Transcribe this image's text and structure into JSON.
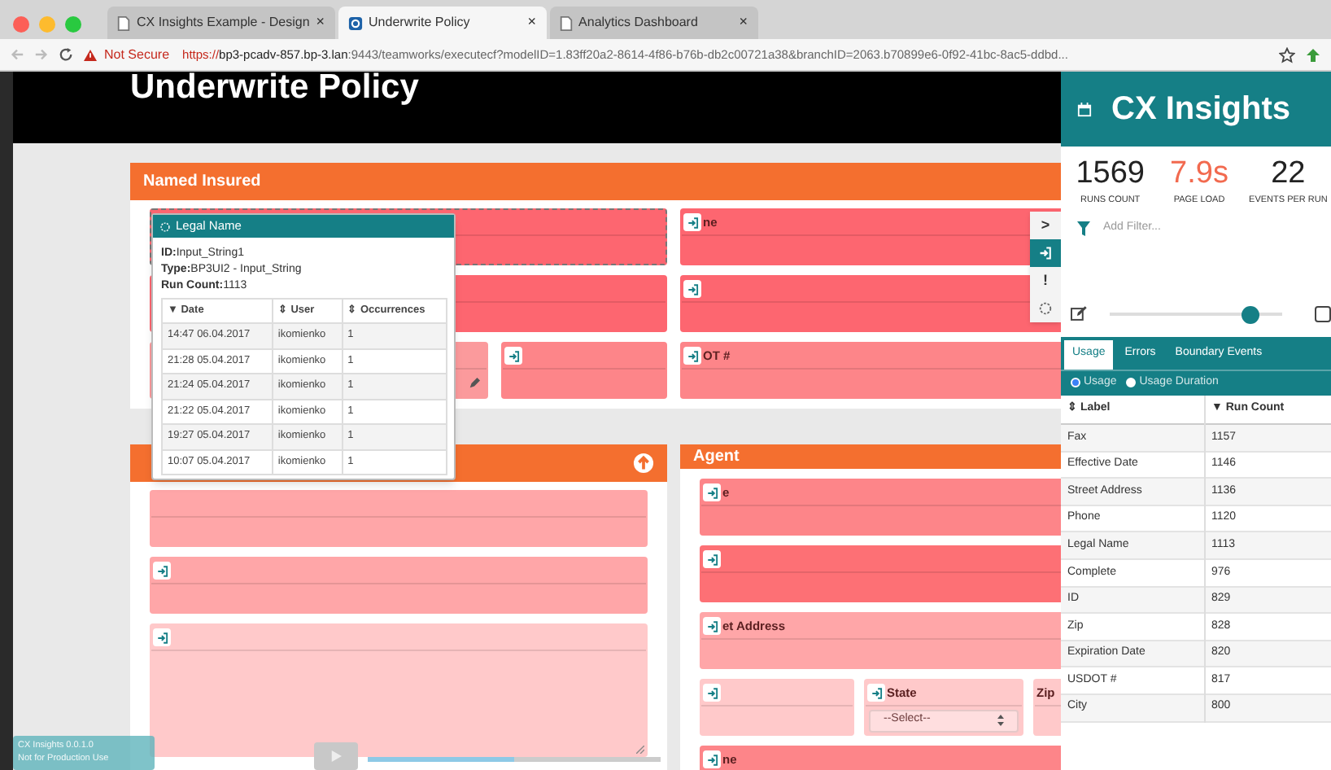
{
  "browser": {
    "tabs": [
      {
        "label": "CX Insights Example - Design",
        "close": "×",
        "selected": false
      },
      {
        "label": "Underwrite Policy",
        "close": "×",
        "selected": true
      },
      {
        "label": "Analytics Dashboard",
        "close": "×",
        "selected": false
      }
    ],
    "security": "Not Secure",
    "url_scheme": "https://",
    "url_host": "bp3-pcadv-857.bp-3.lan",
    "url_rest": ":9443/teamworks/executecf?modelID=1.83ff20a2-8614-4f86-b76b-db2c00721a38&branchID=2063.b70899e6-0f92-41bc-8ac5-ddbd..."
  },
  "page": {
    "title": "Underwrite Policy",
    "cards": [
      {
        "title": "Named Insured",
        "rows": [
          [
            {
              "color": "#fd6670",
              "icon": false,
              "selected": true
            },
            {
              "label": "ne",
              "color": "#fd6670",
              "icon": true,
              "selected": false
            }
          ],
          [
            {
              "color": "#fd6670",
              "icon": false,
              "selected": false
            },
            {
              "color": "#fd6670",
              "icon": true,
              "selected": false
            }
          ],
          [
            {
              "color": "#fb9a9c",
              "icon": false,
              "selected": false,
              "kind": "edit"
            },
            {
              "color": "#fd8589",
              "icon": true,
              "selected": false
            },
            {
              "label": "OT #",
              "color": "#fd8589",
              "icon": true,
              "selected": false
            }
          ]
        ]
      },
      {
        "rows": [
          [
            {
              "color": "#ffa6a8",
              "icon": false,
              "selected": false
            }
          ],
          [
            {
              "color": "#ffa6a8",
              "icon": true,
              "selected": false
            }
          ],
          [
            {
              "color": "#ffc9ca",
              "icon": true,
              "selected": false,
              "kind": "textarea"
            }
          ]
        ]
      },
      {
        "title": "Agent",
        "rows": [
          [
            {
              "label": "e",
              "color": "#fd8589",
              "icon": true,
              "selected": false
            }
          ],
          [
            {
              "color": "#fd7075",
              "icon": true,
              "selected": false
            }
          ],
          [
            {
              "label": "et Address",
              "color": "#ffa6a8",
              "icon": true,
              "selected": false
            }
          ],
          [
            {
              "color": "#ffc9ca",
              "icon": true,
              "selected": false
            },
            {
              "label": "State",
              "color": "#ffc9ca",
              "icon": true,
              "selected": false,
              "kind": "select",
              "value": "--Select--"
            },
            {
              "label": "Zip",
              "color": "#ffc9ca",
              "icon": false,
              "selected": false
            }
          ],
          [
            {
              "label": "ne",
              "color": "#fd8589",
              "icon": true,
              "selected": false
            }
          ]
        ]
      }
    ]
  },
  "popup": {
    "title": "Legal Name",
    "id_label": "ID:",
    "id": "Input_String1",
    "type_label": "Type:",
    "type": "BP3UI2 - Input_String",
    "count_label": "Run Count:",
    "count": "1113",
    "columns": [
      "▼ Date",
      "⇕ User",
      "⇕ Occurrences"
    ],
    "rows": [
      [
        "14:47 06.04.2017",
        "ikomienko",
        "1"
      ],
      [
        "21:28 05.04.2017",
        "ikomienko",
        "1"
      ],
      [
        "21:24 05.04.2017",
        "ikomienko",
        "1"
      ],
      [
        "21:22 05.04.2017",
        "ikomienko",
        "1"
      ],
      [
        "19:27 05.04.2017",
        "ikomienko",
        "1"
      ],
      [
        "10:07 05.04.2017",
        "ikomienko",
        "1"
      ]
    ]
  },
  "side_tools": [
    {
      "glyph": ">",
      "selected": false
    },
    {
      "selected": true
    },
    {
      "glyph": "!",
      "selected": false
    },
    {
      "selected": false
    }
  ],
  "insights": {
    "title": "CX Insights",
    "stats": [
      {
        "value": "1569",
        "label": "RUNS COUNT",
        "kind": "plain"
      },
      {
        "value": "7.9s",
        "label": "PAGE LOAD",
        "kind": "alert"
      },
      {
        "value": "22",
        "label": "EVENTS PER RUN",
        "kind": "plain"
      }
    ],
    "filter_placeholder": "Add Filter...",
    "slider": {
      "level": 0.8
    },
    "checkbox": {
      "checked": false
    },
    "tabs": [
      {
        "label": "Usage",
        "selected": true
      },
      {
        "label": "Errors",
        "selected": false
      },
      {
        "label": "Boundary Events",
        "selected": false
      }
    ],
    "modes": [
      {
        "label": "Usage",
        "selected": true
      },
      {
        "label": "Usage Duration",
        "selected": false
      }
    ],
    "columns": [
      "⇕ Label",
      "▼ Run Count"
    ],
    "rows": [
      [
        "Fax",
        "1157"
      ],
      [
        "Effective Date",
        "1146"
      ],
      [
        "Street Address",
        "1136"
      ],
      [
        "Phone",
        "1120"
      ],
      [
        "Legal Name",
        "1113"
      ],
      [
        "Complete",
        "976"
      ],
      [
        "ID",
        "829"
      ],
      [
        "Zip",
        "828"
      ],
      [
        "Expiration Date",
        "820"
      ],
      [
        "USDOT #",
        "817"
      ],
      [
        "City",
        "800"
      ]
    ]
  },
  "version_badge": [
    "CX Insights 0.0.1.0",
    "Not for Production Use"
  ],
  "player": {
    "level": 0.5
  }
}
